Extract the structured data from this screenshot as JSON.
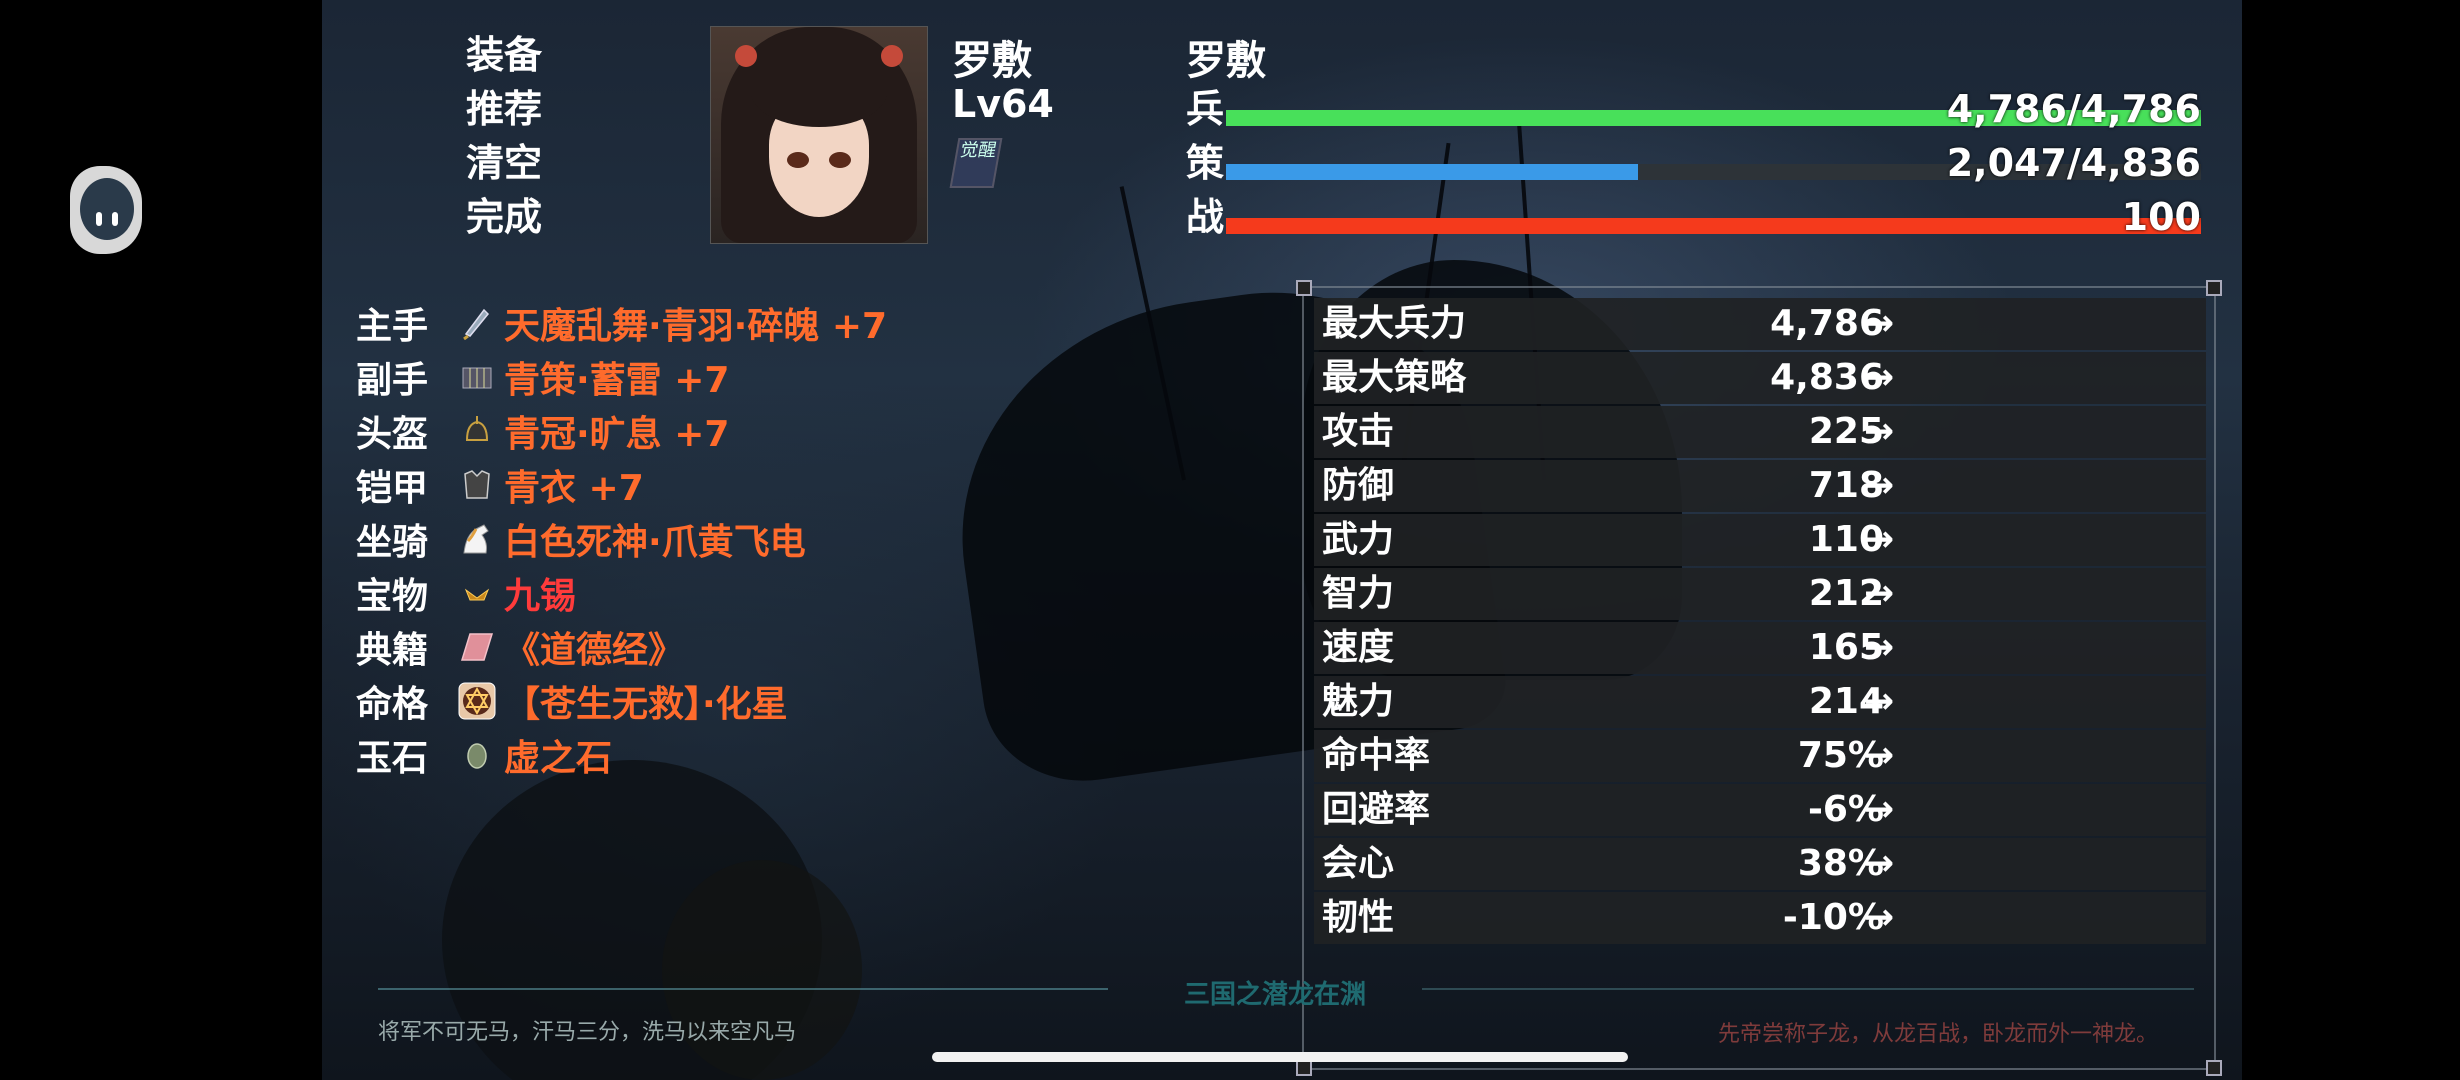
{
  "menu": {
    "items": [
      {
        "label": "装备",
        "selected": true
      },
      {
        "label": "推荐",
        "selected": false
      },
      {
        "label": "清空",
        "selected": false
      },
      {
        "label": "完成",
        "selected": false
      }
    ]
  },
  "hero": {
    "name": "罗敷",
    "level": "Lv64",
    "awaken_badge": "觉醒",
    "panel_name": "罗敷"
  },
  "bars": [
    {
      "label": "兵",
      "value": "4,786/4,786",
      "fraction": 1.0,
      "color": "#48e05a"
    },
    {
      "label": "策",
      "value": "2,047/4,836",
      "fraction": 0.423,
      "color": "#3a9ae8"
    },
    {
      "label": "战",
      "value": "100",
      "fraction": 1.0,
      "color": "#f53a1c"
    }
  ],
  "equipment": [
    {
      "slot": "主手",
      "icon": "weapon-icon",
      "name": "天魔乱舞·青羽·碎魄 +7",
      "color": "#ff6b2c"
    },
    {
      "slot": "副手",
      "icon": "book-scroll-icon",
      "name": "青策·蓄雷 +7",
      "color": "#ff6b2c"
    },
    {
      "slot": "头盔",
      "icon": "helmet-icon",
      "name": "青冠·旷息 +7",
      "color": "#ff6b2c"
    },
    {
      "slot": "铠甲",
      "icon": "armor-icon",
      "name": "青衣 +7",
      "color": "#ff6b2c"
    },
    {
      "slot": "坐骑",
      "icon": "horse-icon",
      "name": "白色死神·爪黄飞电",
      "color": "#ff6b2c"
    },
    {
      "slot": "宝物",
      "icon": "treasure-icon",
      "name": "九锡",
      "color": "#ff3b3b"
    },
    {
      "slot": "典籍",
      "icon": "tome-icon",
      "name": "《道德经》",
      "color": "#ff6b2c"
    },
    {
      "slot": "命格",
      "icon": "hexagram-icon",
      "name": "【苍生无救】·化星",
      "color": "#ff6b2c"
    },
    {
      "slot": "玉石",
      "icon": "gem-icon",
      "name": "虚之石",
      "color": "#ff6b2c"
    }
  ],
  "stats": [
    {
      "name": "最大兵力",
      "value": "4,786",
      "arrow": "→"
    },
    {
      "name": "最大策略",
      "value": "4,836",
      "arrow": "→"
    },
    {
      "name": "攻击",
      "value": "225",
      "arrow": "→"
    },
    {
      "name": "防御",
      "value": "718",
      "arrow": "→"
    },
    {
      "name": "武力",
      "value": "110",
      "arrow": "→"
    },
    {
      "name": "智力",
      "value": "212",
      "arrow": "→"
    },
    {
      "name": "速度",
      "value": "165",
      "arrow": "→"
    },
    {
      "name": "魅力",
      "value": "214",
      "arrow": "→"
    },
    {
      "name": "命中率",
      "value": "75%",
      "arrow": "→"
    },
    {
      "name": "回避率",
      "value": "-6%",
      "arrow": "→"
    },
    {
      "name": "会心",
      "value": "38%",
      "arrow": "→"
    },
    {
      "name": "韧性",
      "value": "-10%",
      "arrow": "→"
    }
  ],
  "footer": {
    "left_quote": "将军不可无马，汗马三分，洗马以来空凡马",
    "center_title": "三国之潜龙在渊",
    "right_quote": "先帝尝称子龙，从龙百战，卧龙而外一神龙。"
  }
}
